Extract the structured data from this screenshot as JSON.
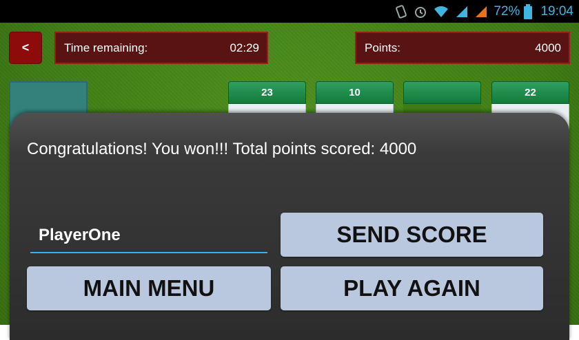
{
  "status_bar": {
    "battery_percent": "72%",
    "time": "19:04",
    "icons": [
      "vibrate-icon",
      "alarm-icon",
      "wifi-icon",
      "signal-icon",
      "signal-icon",
      "battery-icon"
    ],
    "accent_color": "#3fb6e0"
  },
  "header": {
    "back_label": "<",
    "time_label": "Time remaining:",
    "time_value": "02:29",
    "points_label": "Points:",
    "points_value": "4000"
  },
  "tableau": {
    "columns": [
      {
        "count": "23"
      },
      {
        "count": "10"
      },
      {
        "count": ""
      },
      {
        "count": "22"
      }
    ]
  },
  "dialog": {
    "message": "Congratulations! You won!!! Total points scored: 4000",
    "player_name": "PlayerOne",
    "send_score_label": "SEND SCORE",
    "main_menu_label": "MAIN MENU",
    "play_again_label": "PLAY AGAIN"
  },
  "colors": {
    "felt_green": "#3f7d14",
    "panel_red": "#5a1313",
    "back_button_red": "#8e0b0b",
    "button_blue": "#b9c8df",
    "input_underline": "#33b5e5"
  }
}
